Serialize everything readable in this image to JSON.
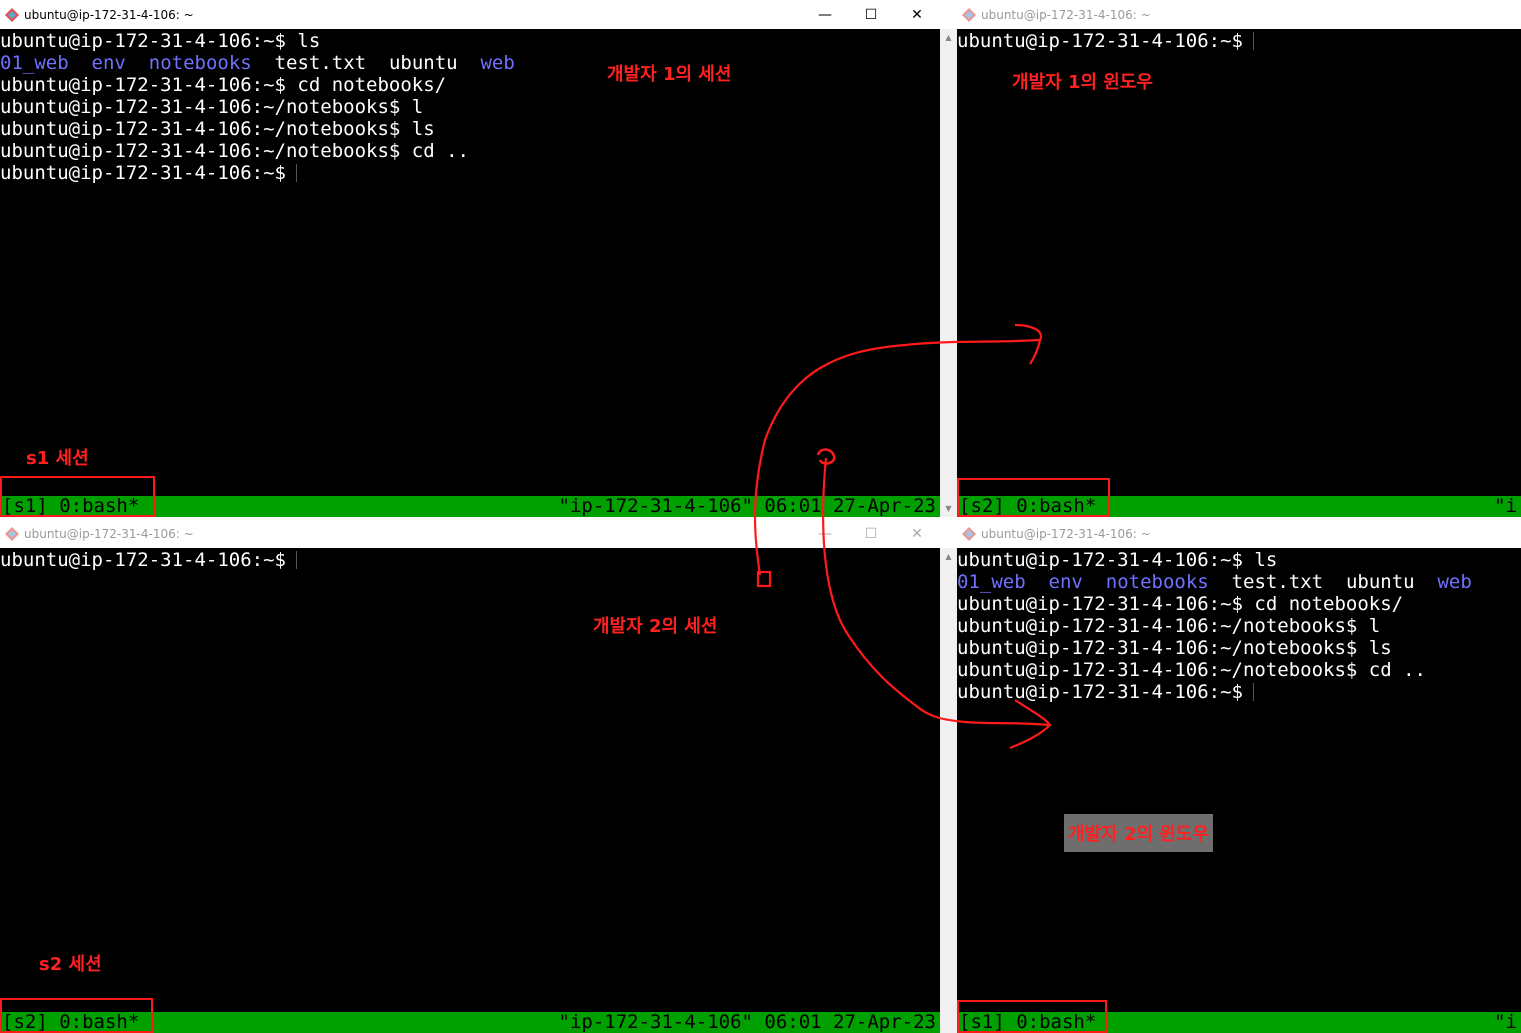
{
  "windows": {
    "tl": {
      "title": "ubuntu@ip-172-31-4-106: ~",
      "lines": [
        [
          {
            "t": "ubuntu@ip-172-31-4-106:~$ ls"
          }
        ],
        [
          {
            "t": "01_web",
            "c": "blue"
          },
          {
            "t": "  "
          },
          {
            "t": "env",
            "c": "blue"
          },
          {
            "t": "  "
          },
          {
            "t": "notebooks",
            "c": "blue"
          },
          {
            "t": "  test.txt  ubuntu  "
          },
          {
            "t": "web",
            "c": "blue"
          }
        ],
        [
          {
            "t": "ubuntu@ip-172-31-4-106:~$ cd notebooks/"
          }
        ],
        [
          {
            "t": "ubuntu@ip-172-31-4-106:~/notebooks$ l"
          }
        ],
        [
          {
            "t": "ubuntu@ip-172-31-4-106:~/notebooks$ ls"
          }
        ],
        [
          {
            "t": "ubuntu@ip-172-31-4-106:~/notebooks$ cd .."
          }
        ],
        [
          {
            "t": "ubuntu@ip-172-31-4-106:~$"
          }
        ]
      ],
      "status_left": "[s1] 0:bash*",
      "status_right": "\"ip-172-31-4-106\" 06:01 27-Apr-23"
    },
    "tr": {
      "title": "ubuntu@ip-172-31-4-106: ~",
      "lines": [
        [
          {
            "t": "ubuntu@ip-172-31-4-106:~$"
          }
        ]
      ],
      "status_left": "[s2] 0:bash*",
      "status_right": "\"i"
    },
    "bl": {
      "title": "ubuntu@ip-172-31-4-106: ~",
      "lines": [
        [
          {
            "t": "ubuntu@ip-172-31-4-106:~$"
          }
        ]
      ],
      "status_left": "[s2] 0:bash*",
      "status_right": "\"ip-172-31-4-106\" 06:01 27-Apr-23"
    },
    "br": {
      "title": "ubuntu@ip-172-31-4-106: ~",
      "lines": [
        [
          {
            "t": "ubuntu@ip-172-31-4-106:~$ ls"
          }
        ],
        [
          {
            "t": "01_web",
            "c": "blue"
          },
          {
            "t": "  "
          },
          {
            "t": "env",
            "c": "blue"
          },
          {
            "t": "  "
          },
          {
            "t": "notebooks",
            "c": "blue"
          },
          {
            "t": "  test.txt  ubuntu  "
          },
          {
            "t": "web",
            "c": "blue"
          }
        ],
        [
          {
            "t": "ubuntu@ip-172-31-4-106:~$ cd notebooks/"
          }
        ],
        [
          {
            "t": "ubuntu@ip-172-31-4-106:~/notebooks$ l"
          }
        ],
        [
          {
            "t": "ubuntu@ip-172-31-4-106:~/notebooks$ ls"
          }
        ],
        [
          {
            "t": "ubuntu@ip-172-31-4-106:~/notebooks$ cd .."
          }
        ],
        [
          {
            "t": "ubuntu@ip-172-31-4-106:~$"
          }
        ]
      ],
      "status_left": "[s1] 0:bash*",
      "status_right": "\"i"
    }
  },
  "controls": {
    "minimize": "—",
    "maximize": "☐",
    "close": "✕"
  },
  "annotations": {
    "dev1_session": "개발자 1의 세션",
    "dev1_window": "개발자 1의 윈도우",
    "s1_session": "s1 세션",
    "dev2_session": "개발자 2의 세션",
    "s2_session": "s2 세션",
    "dev2_window": "개발자 2의 윈도우"
  },
  "colors": {
    "status_bar": "#00a000",
    "annotation": "#ff2020",
    "dir_blue": "#7070ff"
  },
  "icons": {
    "app": "git-bash-icon"
  }
}
